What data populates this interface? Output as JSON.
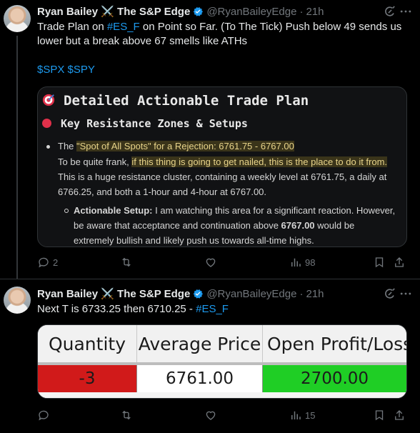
{
  "tweet1": {
    "name": "Ryan Bailey ⚔️ The S&P Edge",
    "handle": "@RyanBaileyEdge",
    "time": "21h",
    "text_a": "Trade Plan on ",
    "cashtag_es": "#ES_F",
    "text_b": " on Point so Far. (To The Tick) Push below 49 sends us",
    "text_line2": "lower but a break above 67 smells like ATHs",
    "tags_line": "$SPX $SPY",
    "card": {
      "title": "Detailed Actionable Trade Plan",
      "subtitle": "Key Resistance Zones & Setups",
      "bullet_the": "The ",
      "bullet_hl": "\"Spot of All Spots\" for a Rejection: 6761.75 - 6767.00",
      "frank_a": "To be quite frank, ",
      "frank_hl": "if this thing is going to get nailed, this is the place to do it from.",
      "line3": "This is a huge resistance cluster, containing a weekly level at 6761.75, a daily at",
      "line4": "6766.25, and both a 1-hour and 4-hour at 6767.00.",
      "setup_label": "Actionable Setup:",
      "setup_text": " I am watching this area for a significant reaction. However,",
      "setup_line2_a": "be aware that acceptance and continuation above ",
      "setup_line2_b": "6767.00",
      "setup_line2_c": " would be",
      "setup_line3": "extremely bullish and likely push us towards all-time highs."
    },
    "actions": {
      "replies": "2",
      "views": "98"
    }
  },
  "tweet2": {
    "name": "Ryan Bailey ⚔️ The S&P Edge",
    "handle": "@RyanBaileyEdge",
    "time": "21h",
    "text_a": "Next T is 6733.25 then 6710.25 - ",
    "cashtag_es": "#ES_F",
    "table": {
      "headers": [
        "Quantity",
        "Average Price",
        "Open Profit/Loss"
      ],
      "values": [
        "-3",
        "6761.00",
        "2700.00"
      ]
    },
    "actions": {
      "views": "15"
    }
  },
  "colors": {
    "link": "#1d9bf0",
    "quantity_cell": "#d11a1a",
    "profit_cell": "#1fce25",
    "verified": "#1d9bf0"
  }
}
